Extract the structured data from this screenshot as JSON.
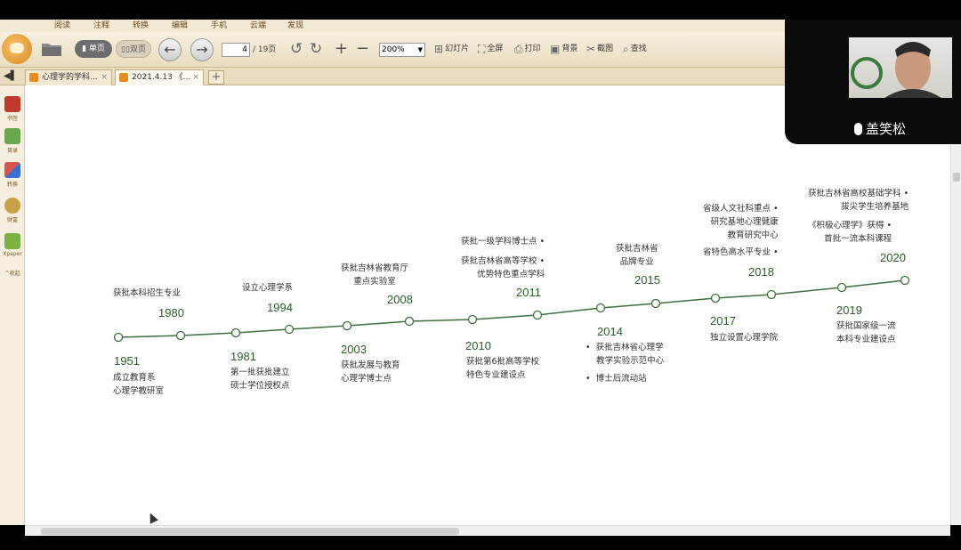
{
  "menu_tabs": [
    "阅读",
    "注释",
    "转换",
    "编辑",
    "手机",
    "云端",
    "发现"
  ],
  "toolbar": {
    "single_page": "单页",
    "double_page": "双页",
    "page_current": "4",
    "page_total": "/ 19页",
    "zoom": "200%",
    "slideshow": "幻灯片",
    "fullscreen": "全屏",
    "print": "打印",
    "background": "背景",
    "screenshot": "截图",
    "search": "查找"
  },
  "tabs": [
    {
      "label": "心理学的学科...",
      "close": "×"
    },
    {
      "label": "2021.4.13 《...",
      "close": "×"
    }
  ],
  "add_tab": "+",
  "sidebar": [
    {
      "label": "书签",
      "icon": "bookmark-icon",
      "color": "#c0392b"
    },
    {
      "label": "目录",
      "icon": "toc-icon",
      "color": "#6aa84f"
    },
    {
      "label": "转换",
      "icon": "convert-icon",
      "color": "#d9534f"
    },
    {
      "label": "财富",
      "icon": "wealth-icon",
      "color": "#c8a04a"
    },
    {
      "label": "Xpaper",
      "icon": "xpaper-icon",
      "color": "#7cb342"
    },
    {
      "label": "^收起",
      "icon": "collapse-icon",
      "color": "#999999"
    }
  ],
  "video": {
    "name": "盖笑松",
    "icon": "mic-icon"
  },
  "timeline": {
    "line_color": "#3f6e3f",
    "years": [
      "1951",
      "1980",
      "1981",
      "1994",
      "2003",
      "2008",
      "2010",
      "2011",
      "2014",
      "2015",
      "2017",
      "2018",
      "2019",
      "2020"
    ],
    "labels": {
      "1951": "成立教育系\n心理学教研室",
      "1980": "获批本科招生专业",
      "1981": "第一批获批建立\n硕士学位授权点",
      "1994": "设立心理学系",
      "2003": "获批发展与教育\n心理学博士点",
      "2008": "获批吉林省教育厅\n重点实验室",
      "2010": "获批第6批高等学校\n特色专业建设点",
      "2011a": "获批一级学科博士点 •",
      "2011b": "获批吉林省高等学校 •\n优势特色重点学科",
      "2014a": "•  获批吉林省心理学\n    教学实验示范中心",
      "2014b": "•  博士后流动站",
      "2015": "获批吉林省\n品牌专业",
      "2017": "独立设置心理学院",
      "2018a": "省级人文社科重点 •\n研究基地心理健康\n教育研究中心",
      "2018b": "省特色高水平专业 •",
      "2019": "获批国家级一流\n本科专业建设点",
      "2020a": "获批吉林省高校基础学科 •\n拔尖学生培养基地",
      "2020b": "《积极心理学》获得 •\n首批一流本科课程"
    }
  }
}
